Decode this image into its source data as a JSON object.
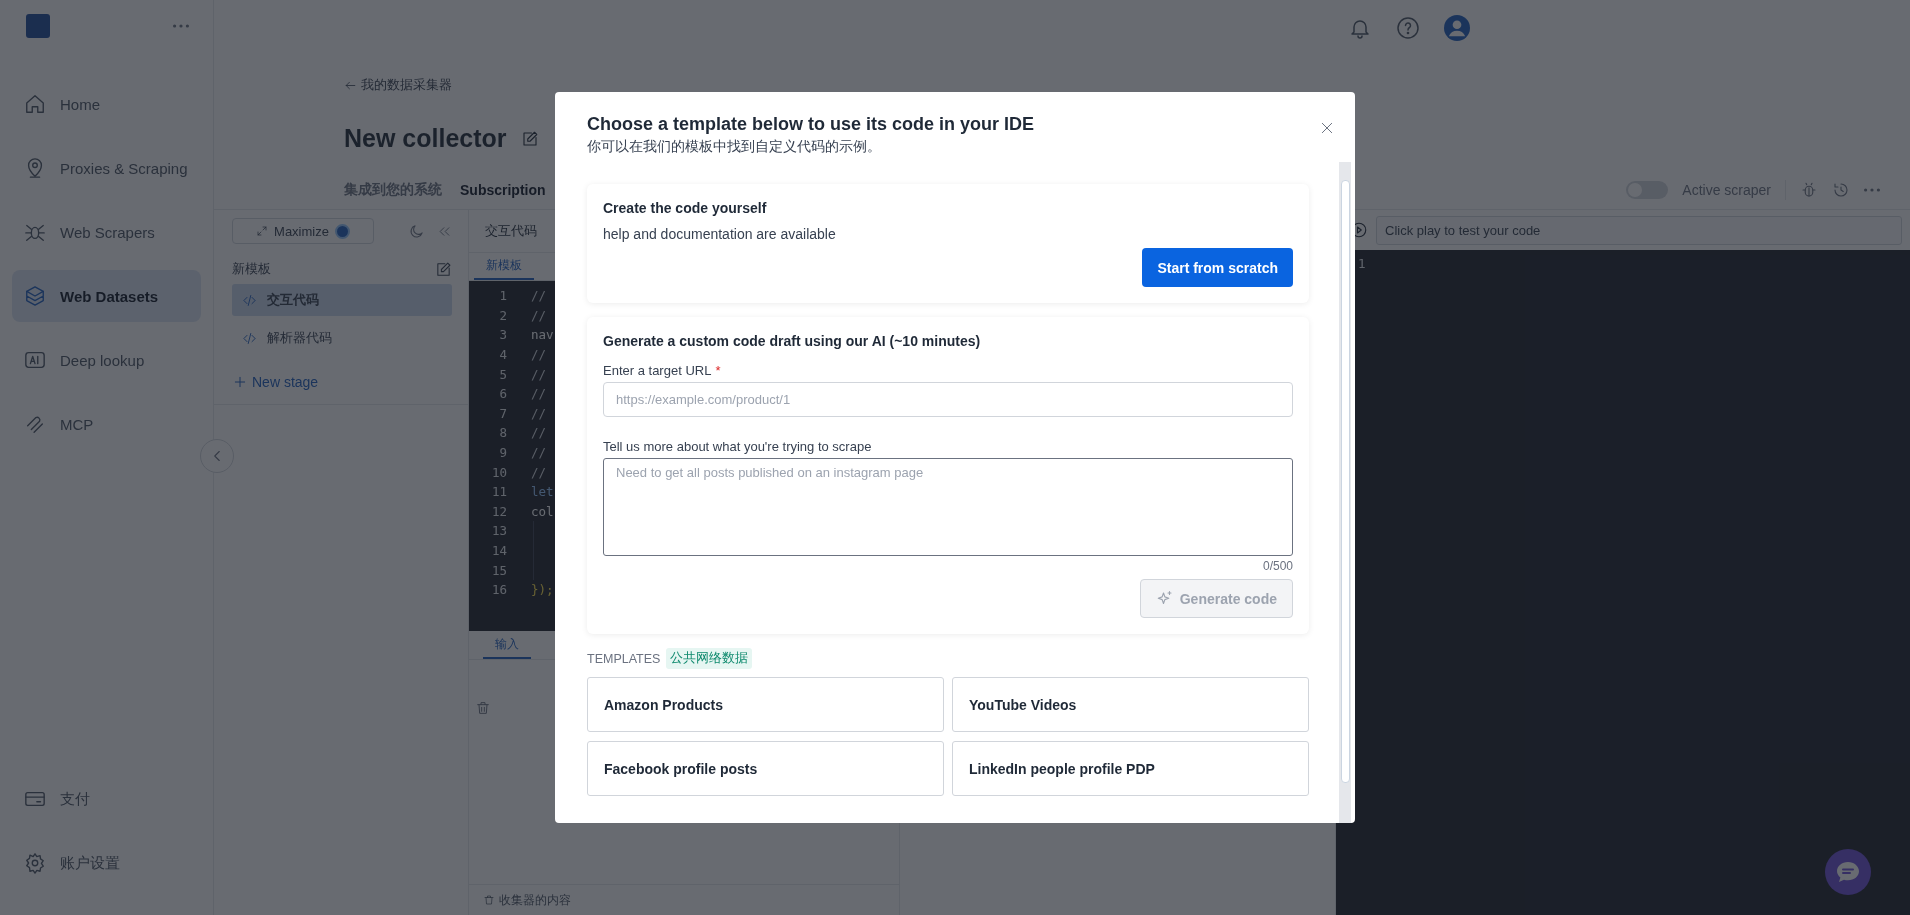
{
  "sidebar": {
    "items": [
      {
        "label": "Home",
        "selected": false
      },
      {
        "label": "Proxies & Scraping",
        "selected": false
      },
      {
        "label": "Web Scrapers",
        "selected": false
      },
      {
        "label": "Web Datasets",
        "selected": true
      },
      {
        "label": "Deep lookup",
        "selected": false
      },
      {
        "label": "MCP",
        "selected": false
      }
    ],
    "bottom_items": [
      {
        "label": "支付",
        "selected": false
      },
      {
        "label": "账户设置",
        "selected": false
      }
    ]
  },
  "breadcrumb": "我的数据采集器",
  "page": {
    "title": "New collector",
    "tabs": [
      "集成到您的系统",
      "Subscription"
    ],
    "active_scraper": {
      "label": "Active scraper",
      "on": false
    }
  },
  "stages": {
    "maximize": "Maximize",
    "group": "新模板",
    "items": [
      {
        "label": "交互代码",
        "selected": true
      },
      {
        "label": "解析器代码",
        "selected": false
      }
    ],
    "new_stage": "New stage"
  },
  "editor": {
    "title": "交互代码",
    "tabs": [
      {
        "label": "新模板",
        "selected": true
      }
    ],
    "lines": [
      {
        "number": "1",
        "kind": "comment",
        "code": "//"
      },
      {
        "number": "2",
        "kind": "comment",
        "code": "//"
      },
      {
        "number": "3",
        "kind": "plain",
        "code": "nav"
      },
      {
        "number": "4",
        "kind": "comment",
        "code": "//"
      },
      {
        "number": "5",
        "kind": "comment",
        "code": "//"
      },
      {
        "number": "6",
        "kind": "comment",
        "code": "//"
      },
      {
        "number": "7",
        "kind": "comment",
        "code": "//"
      },
      {
        "number": "8",
        "kind": "comment",
        "code": "//"
      },
      {
        "number": "9",
        "kind": "comment",
        "code": "//"
      },
      {
        "number": "10",
        "kind": "comment",
        "code": "//"
      },
      {
        "number": "11",
        "kind": "keyword",
        "code": "let"
      },
      {
        "number": "12",
        "kind": "plain",
        "code": "col"
      },
      {
        "number": "13",
        "kind": "blank"
      },
      {
        "number": "14",
        "kind": "blank"
      },
      {
        "number": "15",
        "kind": "blank"
      },
      {
        "number": "16",
        "kind": "punct",
        "code": "});"
      }
    ]
  },
  "input_panel": {
    "tabs": [
      {
        "label": "输入",
        "selected": true
      }
    ],
    "footer": "收集器的内容"
  },
  "console": {
    "placeholder": "Click play to test your code",
    "lines": [
      "1"
    ]
  },
  "modal": {
    "title": "Choose a template below to use its code in your IDE",
    "subtitle": "你可以在我们的模板中找到自定义代码的示例。",
    "scratch": {
      "title": "Create the code yourself",
      "text": "help and documentation are available",
      "button": "Start from scratch"
    },
    "ai": {
      "title": "Generate a custom code draft using our AI (~10 minutes)",
      "url_label": "Enter a target URL",
      "required_mark": "*",
      "url_placeholder": "https://example.com/product/1",
      "details_label": "Tell us more about what you're trying to scrape",
      "details_placeholder": "Need to get all posts published on an instagram page",
      "counter": "0/500",
      "button": "Generate code",
      "button_disabled": true
    },
    "templates_label": "TEMPLATES",
    "templates_tag": "公共网络数据",
    "templates": [
      "Amazon Products",
      "YouTube Videos",
      "Facebook profile posts",
      "LinkedIn people profile PDP"
    ]
  }
}
